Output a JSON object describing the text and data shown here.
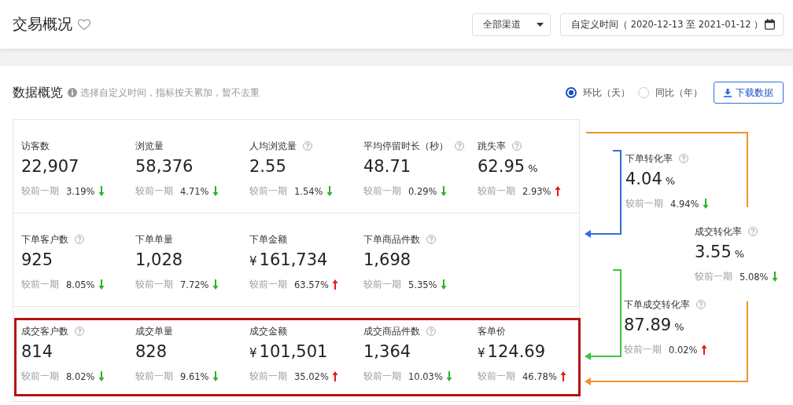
{
  "header": {
    "title": "交易概况",
    "favorited": false,
    "channel_select": {
      "value": "全部渠道"
    },
    "date_range": {
      "value": "自定义时间（ 2020-12-13 至 2021-01-12 ）"
    }
  },
  "overview": {
    "title": "数据概览",
    "hint": "选择自定义时间，指标按天累加，暂不去重",
    "compare_modes": [
      {
        "label": "环比（天）",
        "selected": true
      },
      {
        "label": "同比（年）",
        "selected": false
      }
    ],
    "download_button": "下载数据",
    "rows": [
      {
        "highlighted": false,
        "metrics": [
          {
            "label": "访客数",
            "help": false,
            "value": "22,907",
            "compare_label": "较前一期",
            "change": "3.19%",
            "increase": false
          },
          {
            "label": "浏览量",
            "help": false,
            "value": "58,376",
            "compare_label": "较前一期",
            "change": "4.71%",
            "increase": false
          },
          {
            "label": "人均浏览量",
            "help": true,
            "value": "2.55",
            "compare_label": "较前一期",
            "change": "1.54%",
            "increase": false
          },
          {
            "label": "平均停留时长（秒）",
            "help": true,
            "value": "48.71",
            "compare_label": "较前一期",
            "change": "0.29%",
            "increase": false
          },
          {
            "label": "跳失率",
            "help": true,
            "value": "62.95",
            "unit": "%",
            "compare_label": "较前一期",
            "change": "2.93%",
            "increase": true
          }
        ]
      },
      {
        "highlighted": false,
        "metrics": [
          {
            "label": "下单客户数",
            "help": true,
            "value": "925",
            "compare_label": "较前一期",
            "change": "8.05%",
            "increase": false
          },
          {
            "label": "下单单量",
            "help": false,
            "value": "1,028",
            "compare_label": "较前一期",
            "change": "7.72%",
            "increase": false
          },
          {
            "label": "下单金额",
            "help": false,
            "currency": "¥",
            "value": "161,734",
            "compare_label": "较前一期",
            "change": "63.57%",
            "increase": true
          },
          {
            "label": "下单商品件数",
            "help": true,
            "value": "1,698",
            "compare_label": "较前一期",
            "change": "5.35%",
            "increase": false
          }
        ]
      },
      {
        "highlighted": true,
        "metrics": [
          {
            "label": "成交客户数",
            "help": true,
            "value": "814",
            "compare_label": "较前一期",
            "change": "8.02%",
            "increase": false
          },
          {
            "label": "成交单量",
            "help": false,
            "value": "828",
            "compare_label": "较前一期",
            "change": "9.61%",
            "increase": false
          },
          {
            "label": "成交金额",
            "help": false,
            "currency": "¥",
            "value": "101,501",
            "compare_label": "较前一期",
            "change": "35.02%",
            "increase": true
          },
          {
            "label": "成交商品件数",
            "help": true,
            "value": "1,364",
            "compare_label": "较前一期",
            "change": "10.03%",
            "increase": false
          },
          {
            "label": "客单价",
            "help": false,
            "currency": "¥",
            "value": "124.69",
            "compare_label": "较前一期",
            "change": "46.78%",
            "increase": true
          }
        ]
      }
    ],
    "conversions": [
      {
        "label": "下单转化率",
        "help": true,
        "value": "4.04",
        "unit": "%",
        "compare_label": "较前一期",
        "change": "4.94%",
        "increase": false
      },
      {
        "label": "成交转化率",
        "help": true,
        "value": "3.55",
        "unit": "%",
        "compare_label": "较前一期",
        "change": "5.08%",
        "increase": false
      },
      {
        "label": "下单成交转化率",
        "help": true,
        "value": "87.89",
        "unit": "%",
        "compare_label": "较前一期",
        "change": "0.02%",
        "increase": true
      }
    ],
    "connectors": [
      {
        "color": "#2f6fdf"
      },
      {
        "color": "#3cc43c"
      },
      {
        "color": "#f0912a"
      }
    ]
  }
}
